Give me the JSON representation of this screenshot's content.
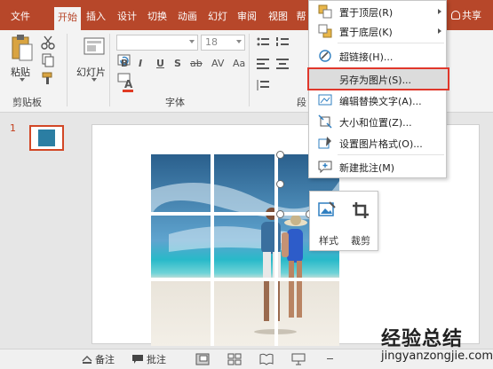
{
  "tabs": [
    {
      "label": "文件",
      "active": false
    },
    {
      "label": "开始",
      "active": true
    },
    {
      "label": "插入",
      "active": false
    },
    {
      "label": "设计",
      "active": false
    },
    {
      "label": "切换",
      "active": false
    },
    {
      "label": "动画",
      "active": false
    },
    {
      "label": "幻灯片放映",
      "display": "幻灯",
      "active": false
    },
    {
      "label": "审阅",
      "active": false
    },
    {
      "label": "视图",
      "active": false
    },
    {
      "label": "帮助",
      "display": "帮",
      "active": false
    }
  ],
  "share_label": "共享",
  "ribbon": {
    "paste_label": "粘贴",
    "clipboard_group": "剪贴板",
    "slides_label": "幻灯片",
    "font_group": "字体",
    "font_size": "18",
    "font_name": "",
    "format_buttons": [
      "B",
      "I",
      "U",
      "S",
      "ab",
      "AV",
      "Aa"
    ],
    "para_group_partial": "段"
  },
  "slide_number": "1",
  "context_menu": {
    "items": [
      {
        "label": "置于顶层(R)",
        "icon": "bring-to-front-icon",
        "submenu": true
      },
      {
        "label": "置于底层(K)",
        "icon": "send-to-back-icon",
        "submenu": true
      },
      {
        "label": "超链接(H)...",
        "icon": "hyperlink-icon",
        "submenu": false
      },
      {
        "label": "另存为图片(S)...",
        "icon": "",
        "submenu": false,
        "highlighted": true
      },
      {
        "label": "编辑替换文字(A)...",
        "icon": "alt-text-icon",
        "submenu": false
      },
      {
        "label": "大小和位置(Z)...",
        "icon": "size-position-icon",
        "submenu": false
      },
      {
        "label": "设置图片格式(O)...",
        "icon": "format-picture-icon",
        "submenu": false
      },
      {
        "label": "新建批注(M)",
        "icon": "new-comment-icon",
        "submenu": false
      }
    ]
  },
  "mini_toolbar": {
    "style_label": "样式",
    "crop_label": "裁剪"
  },
  "statusbar": {
    "notes_label": "备注",
    "comments_label": "批注"
  },
  "watermark": {
    "main": "经验总结",
    "sub": "jingyanzongjie.com"
  },
  "colors": {
    "accent": "#b7472a",
    "highlight_border": "#e0372b"
  }
}
